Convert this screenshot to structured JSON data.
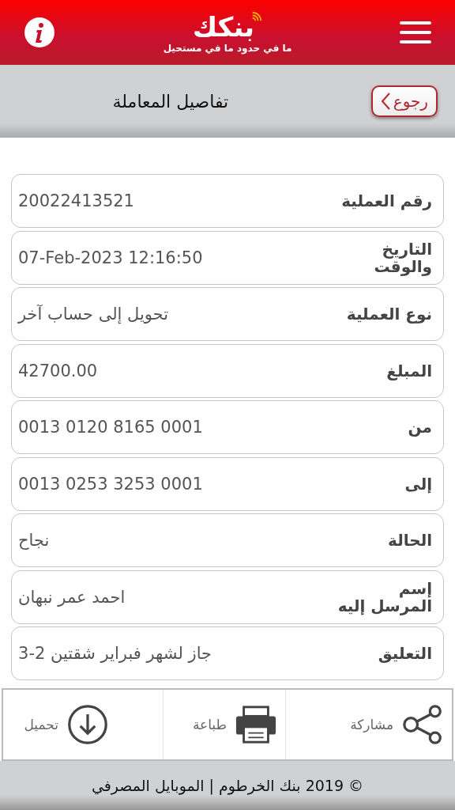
{
  "header": {
    "logo": "بنكك",
    "tagline": "ما في حدود ما في مستحيل"
  },
  "title_bar": {
    "back": "رجوع",
    "title": "تفاصيل المعاملة"
  },
  "fields": [
    {
      "label": "رقم العملية",
      "value": "20022413521"
    },
    {
      "label": "التاريخ والوقت",
      "value": "07-Feb-2023 12:16:50"
    },
    {
      "label": "نوع العملية",
      "value": "تحويل إلى حساب آخر"
    },
    {
      "label": "المبلغ",
      "value": "42700.00"
    },
    {
      "label": "من",
      "value": "0013 0120 8165 0001"
    },
    {
      "label": "إلى",
      "value": "0013 0253 3253 0001"
    },
    {
      "label": "الحالة",
      "value": "نجاح"
    },
    {
      "label": "إسم المرسل إليه",
      "value": "احمد عمر نبهان"
    },
    {
      "label": "التعليق",
      "value": "جاز لشهر فبراير شقتين 2-3"
    }
  ],
  "actions": [
    {
      "kind": "share",
      "label": "مشاركة"
    },
    {
      "kind": "print",
      "label": "طباعة"
    },
    {
      "kind": "download",
      "label": "تحميل"
    }
  ],
  "footer": "© 2019 بنك الخرطوم | الموبايل المصرفي"
}
